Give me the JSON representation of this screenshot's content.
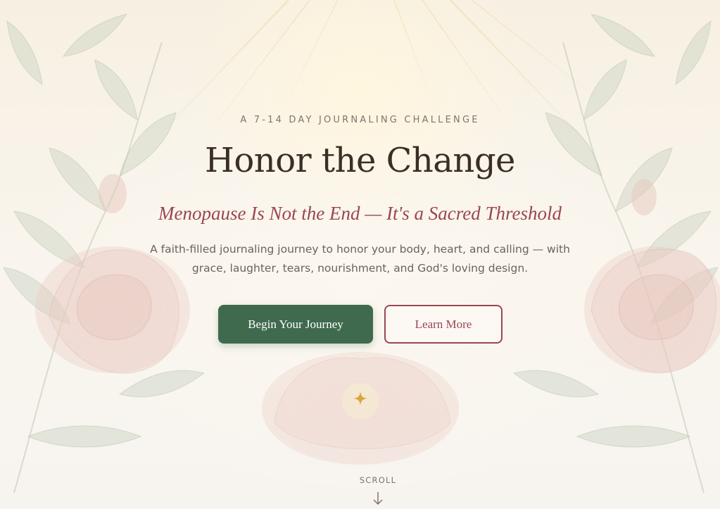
{
  "hero": {
    "eyebrow": "A 7-14 DAY JOURNALING CHALLENGE",
    "title": "Honor the Change",
    "subtitle": "Menopause Is Not the End — It's a Sacred Threshold",
    "description": "A faith-filled journaling journey to honor your body, heart, and calling — with grace, laughter, tears, nourishment, and God's loving design."
  },
  "actions": {
    "primary_label": "Begin Your Journey",
    "secondary_label": "Learn More"
  },
  "scroll": {
    "label": "SCROLL",
    "icon": "arrow-down-icon"
  },
  "decor": {
    "icons": [
      "leaf-icon",
      "peony-icon",
      "sparkle-icon",
      "light-ray-icon"
    ]
  },
  "colors": {
    "background": "#f8f3ea",
    "title": "#3b2e27",
    "accent_rose": "#9b4552",
    "primary_green": "#3f6a4e",
    "sparkle_gold": "#d9a63a"
  }
}
